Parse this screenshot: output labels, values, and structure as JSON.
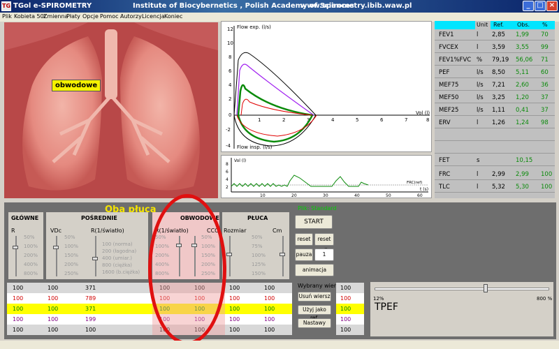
{
  "window": {
    "app_title": "TGol e-SPIROMETRY",
    "institute": "Institute of Biocybernetics , Polish Academy of Sciences",
    "url": "www.spirometry.ibib.waw.pl",
    "icon_text": "TG"
  },
  "menu": [
    "Plik",
    "Kobieta 50l.",
    "Zmienna",
    "Płaty",
    "Opcje",
    "Pomoc",
    "Autorzy",
    "Licencja",
    "Koniec"
  ],
  "lungs": {
    "label": "obwodowe"
  },
  "flow_chart": {
    "ylabel_top": "Flow exp. (l/s)",
    "ylabel_bottom": "Flow insp. (l/s)",
    "xlabel": "Vol (l)",
    "y_ticks": [
      "12",
      "10",
      "8",
      "6",
      "4",
      "2",
      "0",
      "-2",
      "-4"
    ],
    "x_ticks": [
      "1",
      "2",
      "3",
      "4",
      "5",
      "6",
      "7",
      "8"
    ]
  },
  "vol_chart": {
    "ylabel": "Vol (l)",
    "xlabel": "t (s)",
    "frc_label": "FRC(ref)",
    "y_ticks": [
      "8",
      "6",
      "4",
      "2"
    ],
    "x_ticks": [
      "10",
      "20",
      "30",
      "40",
      "50",
      "60"
    ]
  },
  "results": {
    "headers": {
      "unit": "Unit",
      "ref": "Ref.",
      "obs": "Obs.",
      "pct": "%"
    },
    "rows": [
      {
        "name": "FEV1",
        "unit": "l",
        "ref": "2,85",
        "obs": "1,99",
        "pct": "70"
      },
      {
        "name": "FVCEX",
        "unit": "l",
        "ref": "3,59",
        "obs": "3,55",
        "pct": "99"
      },
      {
        "name": "FEV1%FVC",
        "unit": "%",
        "ref": "79,19",
        "obs": "56,06",
        "pct": "71"
      },
      {
        "name": "PEF",
        "unit": "l/s",
        "ref": "8,50",
        "obs": "5,11",
        "pct": "60"
      },
      {
        "name": "MEF75",
        "unit": "l/s",
        "ref": "7,21",
        "obs": "2,60",
        "pct": "36"
      },
      {
        "name": "MEF50",
        "unit": "l/s",
        "ref": "3,25",
        "obs": "1,20",
        "pct": "37"
      },
      {
        "name": "MEF25",
        "unit": "l/s",
        "ref": "1,11",
        "obs": "0,41",
        "pct": "37"
      },
      {
        "name": "ERV",
        "unit": "l",
        "ref": "1,26",
        "obs": "1,24",
        "pct": "98"
      }
    ],
    "bottom_rows": [
      {
        "name": "FET",
        "unit": "s",
        "ref": "",
        "obs": "10,15",
        "pct": ""
      },
      {
        "name": "FRC",
        "unit": "l",
        "ref": "2,99",
        "obs": "2,99",
        "pct": "100"
      },
      {
        "name": "TLC",
        "unit": "l",
        "ref": "5,32",
        "obs": "5,30",
        "pct": "100"
      }
    ]
  },
  "panel": {
    "title": "Oba płuca",
    "file": "Plik: Standard",
    "sections": {
      "glowne": "GŁÓWNE",
      "posrednie": "POŚREDNIE",
      "obwodowe": "OBWODOWE",
      "pluca": "PŁUCA"
    },
    "sliders": {
      "r": {
        "label": "R",
        "ticks": [
          "50%",
          "100%",
          "200%",
          "400%",
          "800%"
        ]
      },
      "vdc": {
        "label": "VDc",
        "ticks": [
          "50%",
          "100%",
          "150%",
          "200%",
          "250%"
        ]
      },
      "ri": {
        "label": "R(1/światło)",
        "ticks": [
          "100 (norma)",
          "200 (łagodna)",
          "400 (umiar.)",
          "800 (ciężka)",
          "1600 (b.ciężka)"
        ]
      },
      "rob": {
        "label": "R(1/światło)",
        "ticks": [
          "50%",
          "100%",
          "200%",
          "400%",
          "800%"
        ]
      },
      "ccc": {
        "label": "CCC",
        "ticks": [
          "50%",
          "100%",
          "150%",
          "200%",
          "250%"
        ]
      },
      "rozmiar": {
        "label": "Rozmiar",
        "ticks": [
          "50%",
          "75%",
          "100%",
          "125%",
          "150%"
        ]
      },
      "cm": {
        "label": "Cm",
        "ticks": [
          "50%",
          "100%",
          "150%",
          "200%",
          "250%"
        ]
      }
    },
    "buttons": {
      "start": "START",
      "reset": "reset",
      "reset_all": "reset all",
      "pauza": "pauza",
      "speed": "1",
      "animacja": "animacja",
      "wybrany": "Wybrany wiersz",
      "usun": "Usuń wiersz",
      "uzyj": "Użyj jako ref.",
      "nastawy": "Nastawy"
    },
    "grid_rows": [
      {
        "cells": [
          "100",
          "100",
          "371",
          "100",
          "100",
          "100",
          "100"
        ],
        "color": "#000000",
        "bg": "#d8d8d8",
        "right": "100"
      },
      {
        "cells": [
          "100",
          "100",
          "789",
          "100",
          "100",
          "100",
          "100"
        ],
        "color": "#d00000",
        "bg": "#ffffff",
        "right": "100"
      },
      {
        "cells": [
          "100",
          "100",
          "371",
          "100",
          "100",
          "100",
          "100"
        ],
        "color": "#008000",
        "bg": "#ffff00",
        "right": "100"
      },
      {
        "cells": [
          "100",
          "100",
          "199",
          "100",
          "100",
          "100",
          "100"
        ],
        "color": "#800080",
        "bg": "#ffffff",
        "right": "100"
      },
      {
        "cells": [
          "100",
          "100",
          "100",
          "100",
          "100",
          "100",
          "100"
        ],
        "color": "#000000",
        "bg": "#d8d8d8",
        "right": "100"
      }
    ],
    "tpef": {
      "label": "TPEF",
      "min_label": "12%",
      "max_label": "800 %",
      "value_fraction": 0.64
    }
  },
  "colors": {
    "title_bar": "#0a246a",
    "results_header": "#00e5ff",
    "obs_green": "#0a8a0a",
    "panel_bg": "#6e6e6e",
    "oba_yellow": "#f5e400",
    "highlight_oval": "#e01010",
    "obwodowe_section": "#f0c8c8"
  }
}
